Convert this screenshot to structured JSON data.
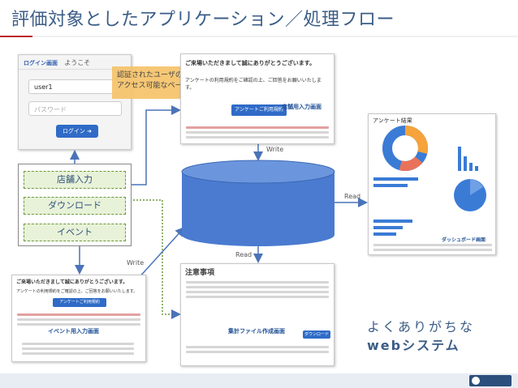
{
  "slide": {
    "title": "評価対象としたアプリケーション／処理フロー"
  },
  "login": {
    "heading": "ログイン画面",
    "welcome": "ようこそ",
    "username_value": "user1",
    "password_placeholder": "パスワード",
    "button_label": "ログイン"
  },
  "callout": {
    "line1": "認証されたユーザのみ",
    "line2": "アクセス可能なページ"
  },
  "menu": {
    "items": [
      {
        "label": "店舗入力"
      },
      {
        "label": "ダウンロード"
      },
      {
        "label": "イベント"
      }
    ]
  },
  "store_screen": {
    "heading": "ご来場いただきまして誠にありがとうございます。",
    "sub": "アンケートの利用規約をご確認の上、ご回答をお願いいたします。",
    "button_label": "アンケートご利用規約",
    "label": "店舗用入力画面"
  },
  "event_screen": {
    "heading": "ご来場いただきまして誠にありがとうございます。",
    "sub": "アンケートの利用規約をご確認の上、ご回答をお願いいたします。",
    "button_label": "アンケートご利用規約",
    "label": "イベント用入力画面"
  },
  "notice_screen": {
    "heading": "注意事項",
    "label": "集計ファイル作成画面",
    "button_label": "ダウンロード"
  },
  "dashboard": {
    "heading": "アンケート結果",
    "label": "ダッシュボード画面"
  },
  "flow": {
    "write_top": "Write",
    "read_right": "Read",
    "read_bottom": "Read",
    "write_left": "Write"
  },
  "tagline": {
    "line1": "よくありがちな",
    "line2": "webシステム"
  },
  "colors": {
    "title": "#3b5d86",
    "cylinder": "#4a7bd0",
    "arrow": "#4a74b8",
    "dotted_path": "#6a9a3a",
    "callout": "#f6c36a"
  }
}
